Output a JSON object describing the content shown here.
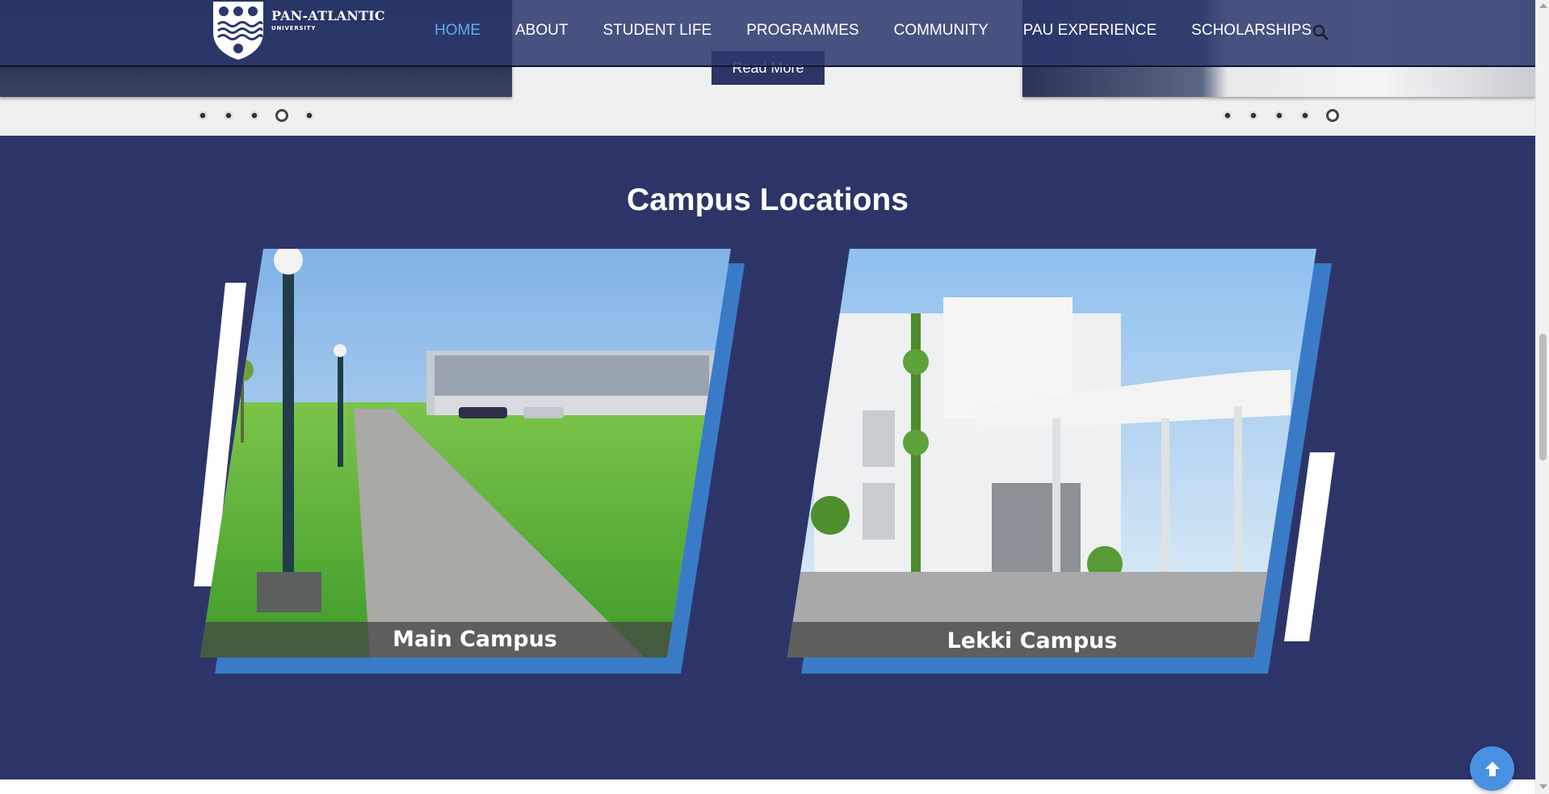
{
  "brand": {
    "name": "PAN-ATLANTIC",
    "sub": "UNIVERSITY"
  },
  "nav": {
    "items": [
      "HOME",
      "ABOUT",
      "STUDENT LIFE",
      "PROGRAMMES",
      "COMMUNITY",
      "PAU EXPERIENCE",
      "SCHOLARSHIPS"
    ],
    "active": "HOME"
  },
  "slider": {
    "read_more": "Read More",
    "left_dots": {
      "count": 5,
      "active_index": 3
    },
    "right_dots": {
      "count": 5,
      "active_index": 4
    }
  },
  "campus": {
    "title": "Campus Locations",
    "cards": [
      {
        "label": "Main Campus"
      },
      {
        "label": "Lekki Campus"
      }
    ]
  },
  "colors": {
    "section_bg": "#2d3568",
    "accent_blue": "#3a7bc8",
    "nav_active": "#63a9f0",
    "header_bg": "#2c386e"
  },
  "icons": {
    "search": "search-icon",
    "to_top": "arrow-up-icon"
  }
}
